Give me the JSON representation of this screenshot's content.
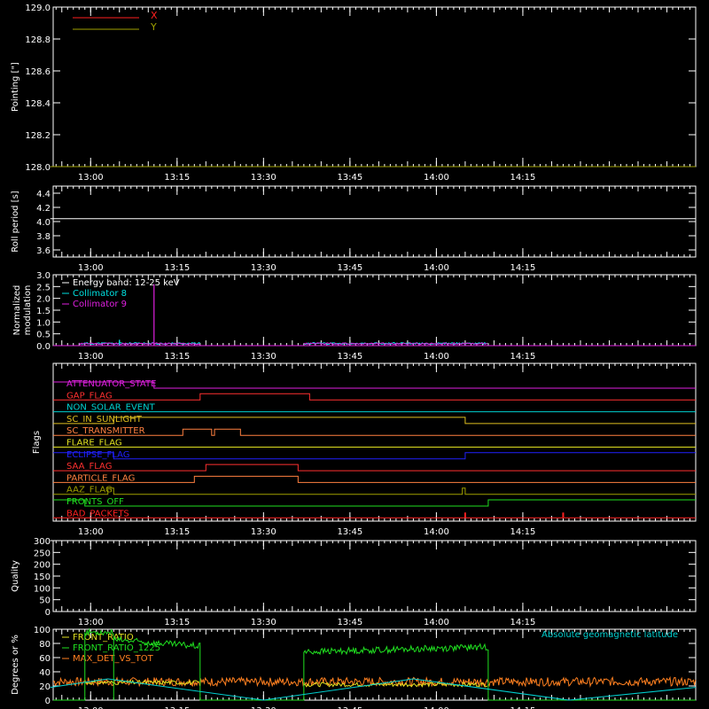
{
  "x_time_ticks": [
    "13:00",
    "13:15",
    "13:30",
    "13:45",
    "14:00",
    "14:15"
  ],
  "chart_data": [
    {
      "id": "pointing",
      "type": "line",
      "ylabel": "Pointing [\"]",
      "ylim": [
        128.0,
        129.0
      ],
      "yticks": [
        "128.0",
        "128.2",
        "128.4",
        "128.6",
        "128.8",
        "129.0"
      ],
      "legend": [
        {
          "name": "X",
          "color": "#ff2020"
        },
        {
          "name": "Y",
          "color": "#a0a000"
        }
      ],
      "series": [
        {
          "name": "Y",
          "color": "#a0a000",
          "t": [
            "12:53",
            "14:45"
          ],
          "values": [
            128.0,
            128.0
          ]
        }
      ]
    },
    {
      "id": "roll",
      "type": "line",
      "ylabel": "Roll period [s]",
      "ylim": [
        3.5,
        4.5
      ],
      "yticks": [
        "3.6",
        "3.8",
        "4.0",
        "4.2",
        "4.4"
      ],
      "series": [
        {
          "name": "roll",
          "color": "#ffffff",
          "t": [
            "12:53",
            "14:45"
          ],
          "values": [
            4.04,
            4.04
          ]
        }
      ]
    },
    {
      "id": "modulation",
      "type": "line",
      "ylabel": "Normalized modulation",
      "ylim": [
        0.0,
        3.0
      ],
      "yticks": [
        "0.0",
        "0.5",
        "1.0",
        "1.5",
        "2.0",
        "2.5",
        "3.0"
      ],
      "legend": [
        {
          "name": "Energy band: 12-25 keV",
          "color": "#ffffff"
        },
        {
          "name": "Collimator 8",
          "color": "#00e0e0"
        },
        {
          "name": "Collimator 9",
          "color": "#e020e0"
        }
      ],
      "segments": [
        {
          "t": [
            "12:58",
            "13:19"
          ],
          "level": 0.05
        },
        {
          "t": [
            "13:37",
            "14:09"
          ],
          "level": 0.05
        }
      ],
      "spike": {
        "t": "13:11",
        "value": 2.6
      }
    },
    {
      "id": "flags",
      "type": "line",
      "ylabel": "Flags",
      "flags": [
        {
          "name": "ATTENUATOR_STATE",
          "color": "#e020e0",
          "transitions": [
            [
              "12:53",
              1
            ],
            [
              "13:11",
              0
            ],
            [
              "14:45",
              0
            ]
          ]
        },
        {
          "name": "GAP_FLAG",
          "color": "#ff3030",
          "transitions": [
            [
              "12:53",
              0
            ],
            [
              "13:19",
              1
            ],
            [
              "13:38",
              0
            ],
            [
              "14:45",
              0
            ]
          ]
        },
        {
          "name": "NON_SOLAR_EVENT",
          "color": "#00d0d0",
          "transitions": [
            [
              "12:53",
              0
            ],
            [
              "14:45",
              0
            ]
          ]
        },
        {
          "name": "SC_IN_SUNLIGHT",
          "color": "#e0c020",
          "transitions": [
            [
              "12:53",
              0
            ],
            [
              "13:04",
              1
            ],
            [
              "14:05",
              0
            ],
            [
              "14:45",
              0
            ]
          ]
        },
        {
          "name": "SC_TRANSMITTER",
          "color": "#ff8040",
          "transitions": [
            [
              "12:53",
              0
            ],
            [
              "13:16",
              1
            ],
            [
              "13:21",
              0
            ],
            [
              "13:21.5",
              1
            ],
            [
              "13:26",
              0
            ],
            [
              "14:45",
              0
            ]
          ]
        },
        {
          "name": "FLARE_FLAG",
          "color": "#e0e020",
          "transitions": [
            [
              "12:53",
              0
            ],
            [
              "14:45",
              0
            ]
          ]
        },
        {
          "name": "ECLIPSE_FLAG",
          "color": "#2020ff",
          "transitions": [
            [
              "12:53",
              1
            ],
            [
              "13:04",
              0
            ],
            [
              "14:05",
              1
            ],
            [
              "14:45",
              1
            ]
          ]
        },
        {
          "name": "SAA_FLAG",
          "color": "#ff3030",
          "transitions": [
            [
              "12:53",
              0
            ],
            [
              "13:20",
              1
            ],
            [
              "13:36",
              0
            ],
            [
              "14:45",
              0
            ]
          ]
        },
        {
          "name": "PARTICLE_FLAG",
          "color": "#ff8040",
          "transitions": [
            [
              "12:53",
              0
            ],
            [
              "13:18",
              1
            ],
            [
              "13:36",
              0
            ],
            [
              "14:45",
              0
            ]
          ]
        },
        {
          "name": "AAZ_FLAG",
          "color": "#a0a000",
          "transitions": [
            [
              "12:53",
              0
            ],
            [
              "13:03",
              1
            ],
            [
              "13:04",
              0
            ],
            [
              "14:04.5",
              1
            ],
            [
              "14:05",
              0
            ],
            [
              "14:45",
              0
            ]
          ]
        },
        {
          "name": "FRONTS_OFF",
          "color": "#20e020",
          "transitions": [
            [
              "12:53",
              1
            ],
            [
              "12:59",
              0
            ],
            [
              "14:09",
              1
            ],
            [
              "14:45",
              1
            ]
          ]
        },
        {
          "name": "BAD_PACKETS",
          "color": "#ff2020",
          "ticks": [
            "14:05",
            "14:22"
          ]
        }
      ]
    },
    {
      "id": "quality",
      "type": "line",
      "ylabel": "Quality",
      "ylim": [
        0,
        300
      ],
      "yticks": [
        "0",
        "50",
        "100",
        "150",
        "200",
        "250",
        "300"
      ],
      "series": [
        {
          "name": "quality",
          "color": "#ffffff",
          "t": [
            "12:53",
            "14:45"
          ],
          "values": [
            300,
            300
          ]
        }
      ]
    },
    {
      "id": "ratios",
      "type": "line",
      "ylabel": "Degrees or %",
      "ylim": [
        0,
        100
      ],
      "yticks": [
        "0",
        "20",
        "40",
        "60",
        "80",
        "100"
      ],
      "legend": [
        {
          "name": "FRONT_RATIO",
          "color": "#e0e020"
        },
        {
          "name": "FRONT_RATIO_1225",
          "color": "#20e020"
        },
        {
          "name": "MAX_DET_VS_TOT",
          "color": "#ff8020"
        }
      ],
      "annotation": {
        "text": "Absolute geomagnetic latitude",
        "color": "#00d0d0"
      },
      "geomag_latitude": {
        "t": [
          "12:53",
          "13:03",
          "13:30",
          "13:56",
          "14:23",
          "14:45"
        ],
        "values": [
          18,
          30,
          0,
          30,
          0,
          18
        ]
      },
      "front_ratio_1225": {
        "segments": [
          {
            "t": [
              "12:59",
              "13:04"
            ],
            "start": 96,
            "end": 96
          },
          {
            "t": [
              "13:04",
              "13:19"
            ],
            "start": 85,
            "end": 76
          },
          {
            "t": [
              "13:37",
              "14:09"
            ],
            "start": 68,
            "end": 75
          }
        ]
      },
      "front_ratio": {
        "segments": [
          {
            "t": [
              "12:59",
              "13:19"
            ],
            "level": 25
          },
          {
            "t": [
              "13:37",
              "14:09"
            ],
            "level": 22
          }
        ]
      },
      "max_det_vs_tot": {
        "t": [
          "12:53",
          "14:45"
        ],
        "level": 26
      }
    }
  ]
}
